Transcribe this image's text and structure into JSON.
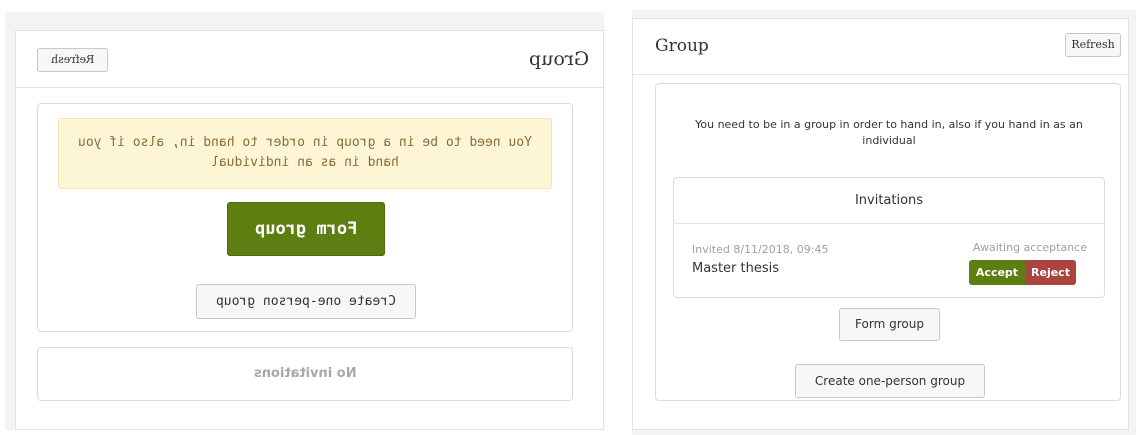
{
  "left_panel": {
    "title": "Group",
    "refresh_label": "Refresh",
    "warning_text": "You need to be in a group in order to hand in, also if you hand in as an individual",
    "form_group_label": "Form group",
    "create_one_person_label": "Create one-person group",
    "no_invitations_text": "No invitations",
    "colors": {
      "primary": "#5d7f12",
      "warning_bg": "#fcf6d4",
      "warning_text": "#8a6d3b"
    }
  },
  "right_panel": {
    "title": "Group",
    "refresh_label": "Refresh",
    "message": "You need to be in a group in order to hand in, also if you hand in as an individual",
    "invitations": {
      "header": "Invitations",
      "items": [
        {
          "date": "Invited 8/11/2018, 09:45",
          "name": "Master thesis",
          "status": "Awaiting acceptance",
          "accept_label": "Accept",
          "reject_label": "Reject"
        }
      ]
    },
    "form_group_label": "Form group",
    "create_one_person_label": "Create one-person group",
    "colors": {
      "accept": "#5d7f12",
      "reject": "#a9443f"
    }
  }
}
